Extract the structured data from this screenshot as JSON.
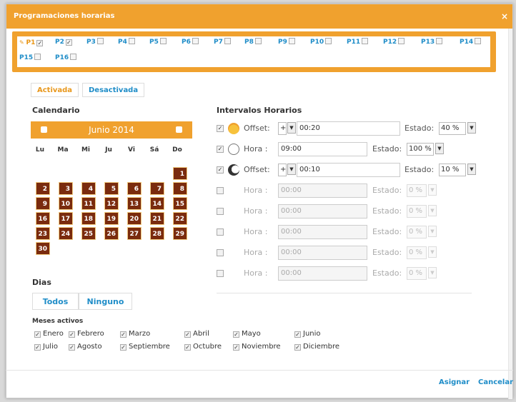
{
  "dialog": {
    "title": "Programaciones horarias",
    "close_label": "×"
  },
  "programs": [
    {
      "label": "P1",
      "checked": "✓",
      "selected": true
    },
    {
      "label": "P2",
      "checked": "✓"
    },
    {
      "label": "P3",
      "checked": ""
    },
    {
      "label": "P4",
      "checked": ""
    },
    {
      "label": "P5",
      "checked": ""
    },
    {
      "label": "P6",
      "checked": ""
    },
    {
      "label": "P7",
      "checked": ""
    },
    {
      "label": "P8",
      "checked": ""
    },
    {
      "label": "P9",
      "checked": ""
    },
    {
      "label": "P10",
      "checked": ""
    },
    {
      "label": "P11",
      "checked": ""
    },
    {
      "label": "P12",
      "checked": ""
    },
    {
      "label": "P13",
      "checked": ""
    },
    {
      "label": "P14",
      "checked": ""
    },
    {
      "label": "P15",
      "checked": ""
    },
    {
      "label": "P16",
      "checked": ""
    }
  ],
  "mode": {
    "on": "Activada",
    "off": "Desactivada"
  },
  "calendar": {
    "title": "Calendario",
    "month": "Junio 2014",
    "weekdays": [
      "Lu",
      "Ma",
      "Mi",
      "Ju",
      "Vi",
      "Sá",
      "Do"
    ],
    "days": [
      "1",
      "2",
      "3",
      "4",
      "5",
      "6",
      "7",
      "8",
      "9",
      "10",
      "11",
      "12",
      "13",
      "14",
      "15",
      "16",
      "17",
      "18",
      "19",
      "20",
      "21",
      "22",
      "23",
      "24",
      "25",
      "26",
      "27",
      "28",
      "29",
      "30"
    ]
  },
  "days_section": {
    "title": "Dias",
    "all": "Todos",
    "none": "Ninguno"
  },
  "months": {
    "title": "Meses activos",
    "items": [
      "Enero",
      "Febrero",
      "Marzo",
      "Abril",
      "Mayo",
      "Junio",
      "Julio",
      "Agosto",
      "Septiembre",
      "Octubre",
      "Noviembre",
      "Diciembre"
    ],
    "check": "✓"
  },
  "intervals": {
    "title": "Intervalos Horarios",
    "state_label": "Estado:",
    "rows": [
      {
        "checked": "✓",
        "icon": "sunrise",
        "label": "Offset:",
        "sign": "+",
        "value": "00:20",
        "state": "40 %",
        "enabled": true
      },
      {
        "checked": "✓",
        "icon": "clock",
        "label": "Hora :",
        "value": "09:00",
        "state": "100 %",
        "enabled": true
      },
      {
        "checked": "✓",
        "icon": "moon",
        "label": "Offset:",
        "sign": "+",
        "value": "00:10",
        "state": "10 %",
        "enabled": true
      },
      {
        "checked": "",
        "label": "Hora :",
        "value": "00:00",
        "state": "0 %",
        "enabled": false
      },
      {
        "checked": "",
        "label": "Hora :",
        "value": "00:00",
        "state": "0 %",
        "enabled": false
      },
      {
        "checked": "",
        "label": "Hora :",
        "value": "00:00",
        "state": "0 %",
        "enabled": false
      },
      {
        "checked": "",
        "label": "Hora :",
        "value": "00:00",
        "state": "0 %",
        "enabled": false
      },
      {
        "checked": "",
        "label": "Hora :",
        "value": "00:00",
        "state": "0 %",
        "enabled": false
      }
    ]
  },
  "footer": {
    "assign": "Asignar",
    "cancel": "Cancelar"
  }
}
